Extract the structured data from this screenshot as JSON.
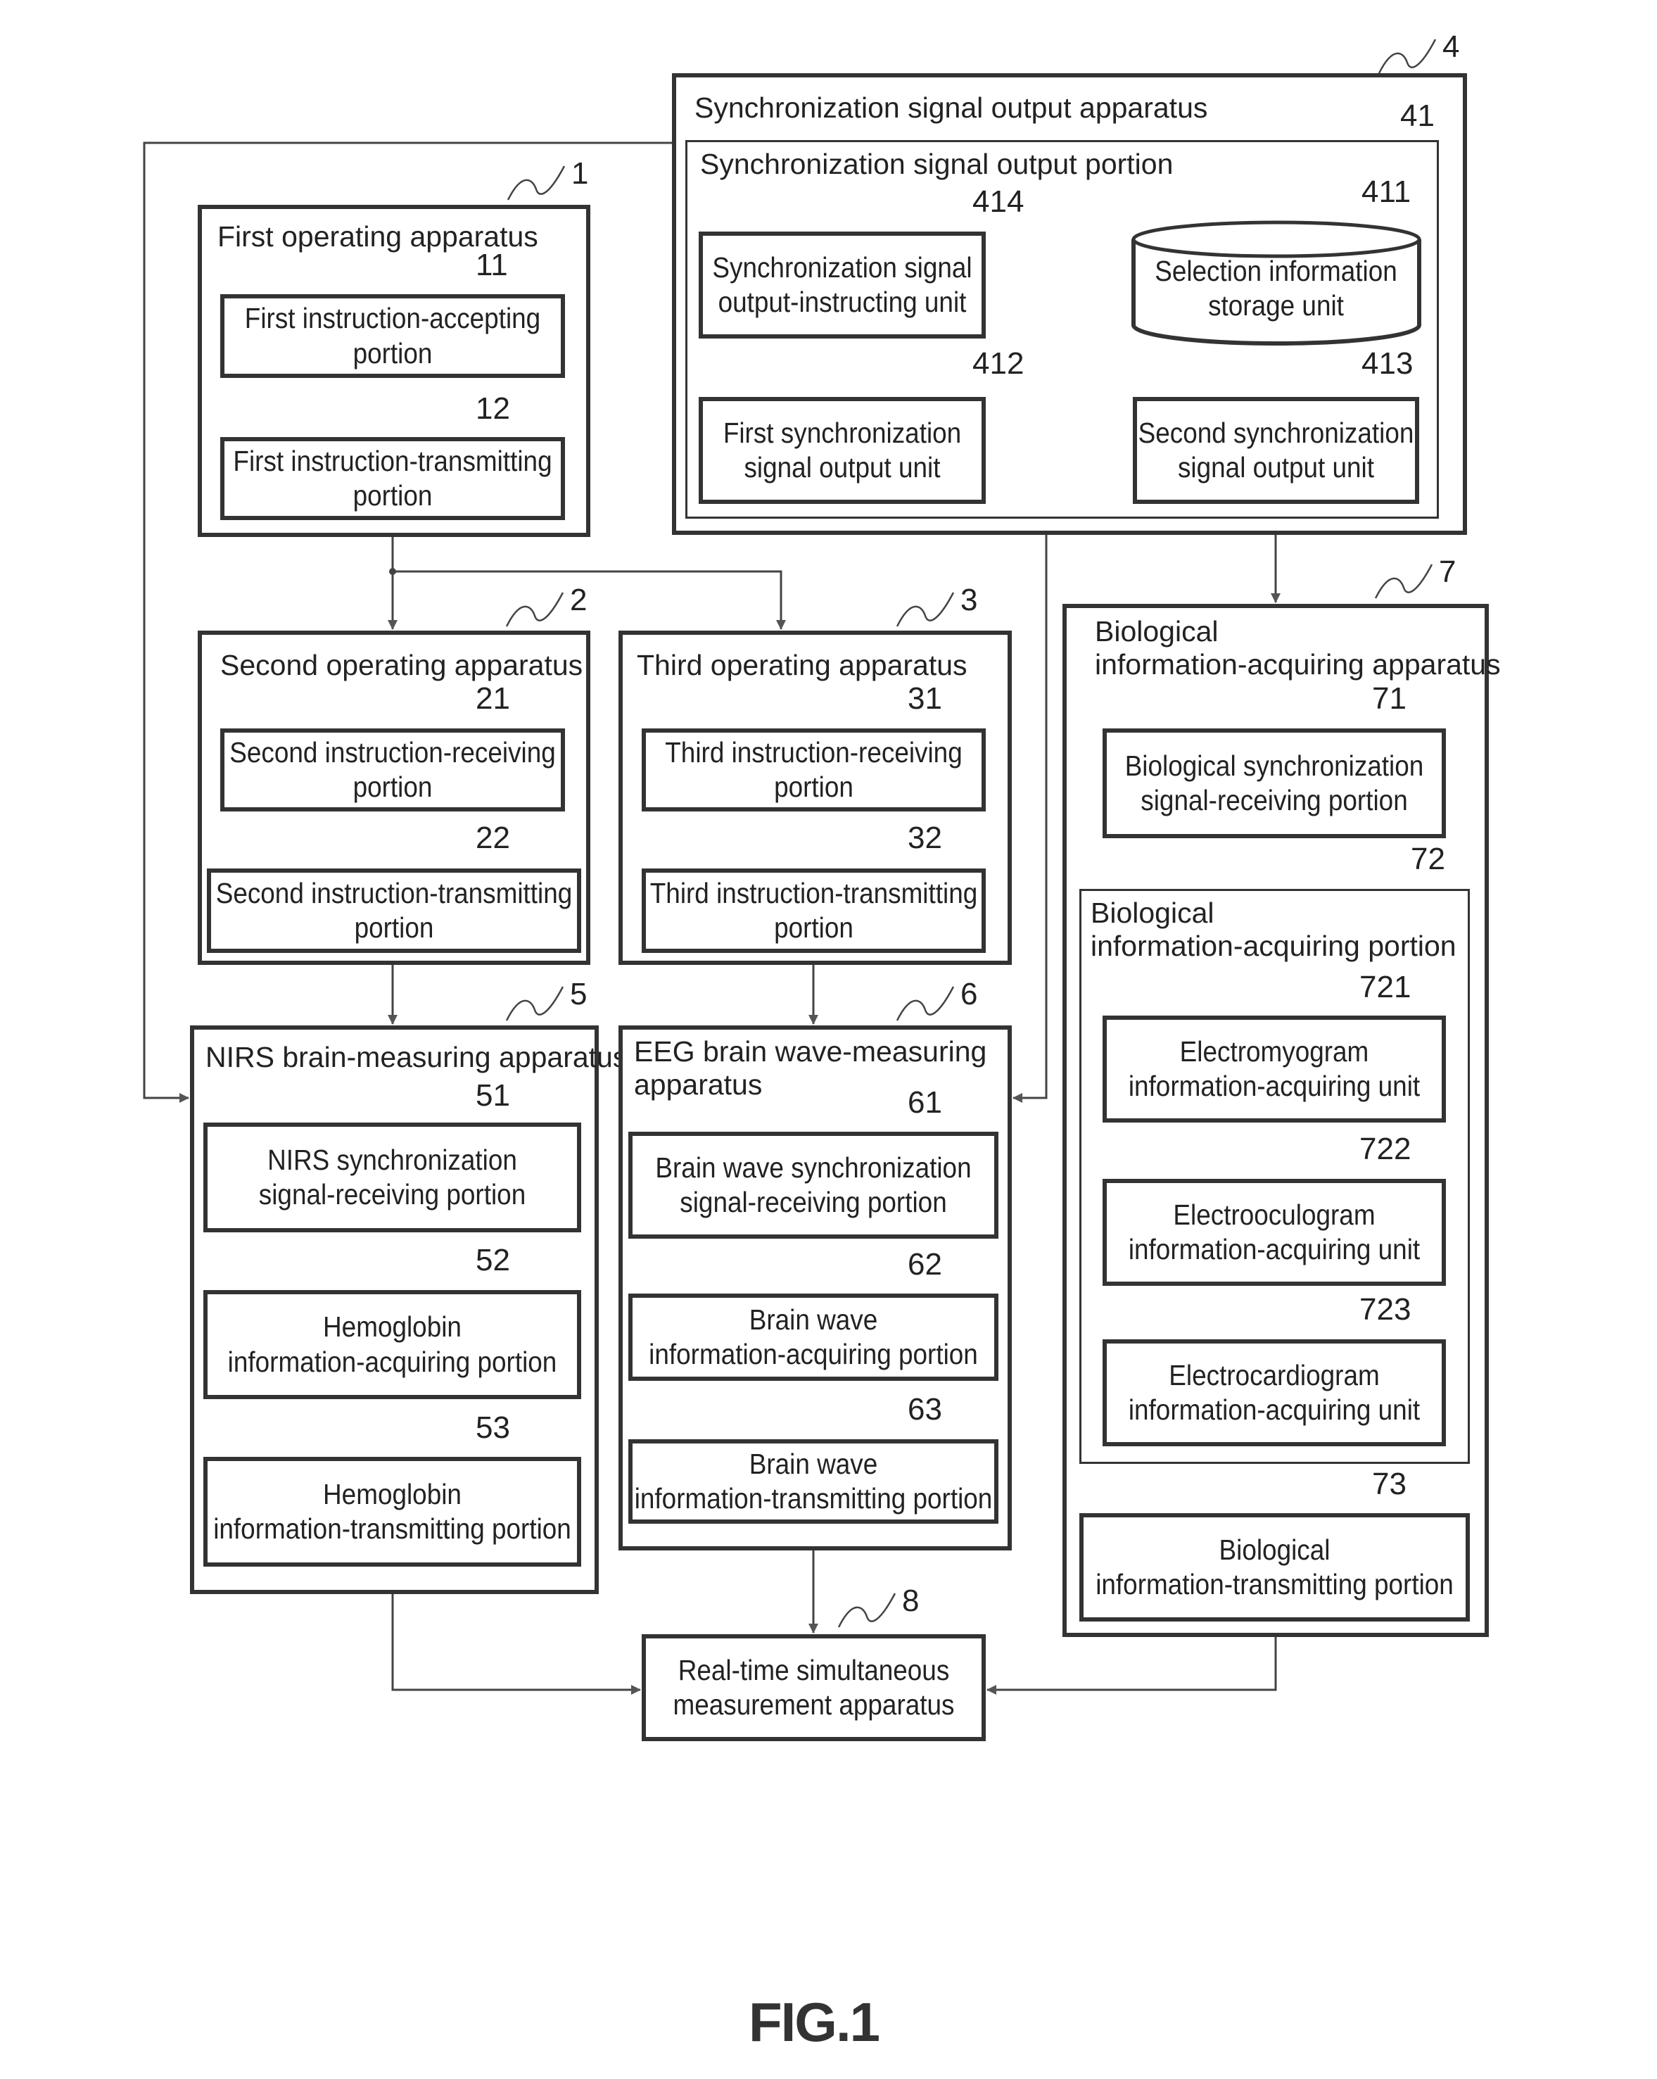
{
  "figure_label": "FIG.1",
  "apparatus": {
    "sync_output": {
      "ref": "4",
      "title": "Synchronization signal output apparatus",
      "portion": {
        "ref": "41",
        "title": "Synchronization signal output portion",
        "units": {
          "instructing": {
            "ref": "414",
            "lines": [
              "Synchronization signal",
              "output-instructing unit"
            ]
          },
          "storage": {
            "ref": "411",
            "lines": [
              "Selection information",
              "storage unit"
            ]
          },
          "first_output": {
            "ref": "412",
            "lines": [
              "First synchronization",
              "signal output unit"
            ]
          },
          "second_output": {
            "ref": "413",
            "lines": [
              "Second synchronization",
              "signal output unit"
            ]
          }
        }
      }
    },
    "first_operating": {
      "ref": "1",
      "title": "First operating apparatus",
      "units": [
        {
          "ref": "11",
          "lines": [
            "First instruction-accepting",
            "portion"
          ]
        },
        {
          "ref": "12",
          "lines": [
            "First instruction-transmitting",
            "portion"
          ]
        }
      ]
    },
    "second_operating": {
      "ref": "2",
      "title": "Second operating apparatus",
      "units": [
        {
          "ref": "21",
          "lines": [
            "Second instruction-receiving",
            "portion"
          ]
        },
        {
          "ref": "22",
          "lines": [
            "Second instruction-transmitting",
            "portion"
          ]
        }
      ]
    },
    "third_operating": {
      "ref": "3",
      "title": "Third operating apparatus",
      "units": [
        {
          "ref": "31",
          "lines": [
            "Third instruction-receiving",
            "portion"
          ]
        },
        {
          "ref": "32",
          "lines": [
            "Third instruction-transmitting",
            "portion"
          ]
        }
      ]
    },
    "nirs": {
      "ref": "5",
      "title": "NIRS brain-measuring apparatus",
      "units": [
        {
          "ref": "51",
          "lines": [
            "NIRS synchronization",
            "signal-receiving portion"
          ]
        },
        {
          "ref": "52",
          "lines": [
            "Hemoglobin",
            "information-acquiring portion"
          ]
        },
        {
          "ref": "53",
          "lines": [
            "Hemoglobin",
            "information-transmitting portion"
          ]
        }
      ]
    },
    "eeg": {
      "ref": "6",
      "title_lines": [
        "EEG brain wave-measuring",
        "apparatus"
      ],
      "units": [
        {
          "ref": "61",
          "lines": [
            "Brain wave synchronization",
            "signal-receiving portion"
          ]
        },
        {
          "ref": "62",
          "lines": [
            "Brain wave",
            "information-acquiring portion"
          ]
        },
        {
          "ref": "63",
          "lines": [
            "Brain wave",
            "information-transmitting portion"
          ]
        }
      ]
    },
    "biological": {
      "ref": "7",
      "title_lines": [
        "Biological",
        "information-acquiring apparatus"
      ],
      "receiving": {
        "ref": "71",
        "lines": [
          "Biological synchronization",
          "signal-receiving portion"
        ]
      },
      "acquiring_portion": {
        "ref": "72",
        "title_lines": [
          "Biological",
          "information-acquiring portion"
        ],
        "units": [
          {
            "ref": "721",
            "lines": [
              "Electromyogram",
              "information-acquiring unit"
            ]
          },
          {
            "ref": "722",
            "lines": [
              "Electrooculogram",
              "information-acquiring unit"
            ]
          },
          {
            "ref": "723",
            "lines": [
              "Electrocardiogram",
              "information-acquiring unit"
            ]
          }
        ]
      },
      "transmitting": {
        "ref": "73",
        "lines": [
          "Biological",
          "information-transmitting portion"
        ]
      }
    },
    "realtime": {
      "ref": "8",
      "lines": [
        "Real-time simultaneous",
        "measurement apparatus"
      ]
    }
  }
}
